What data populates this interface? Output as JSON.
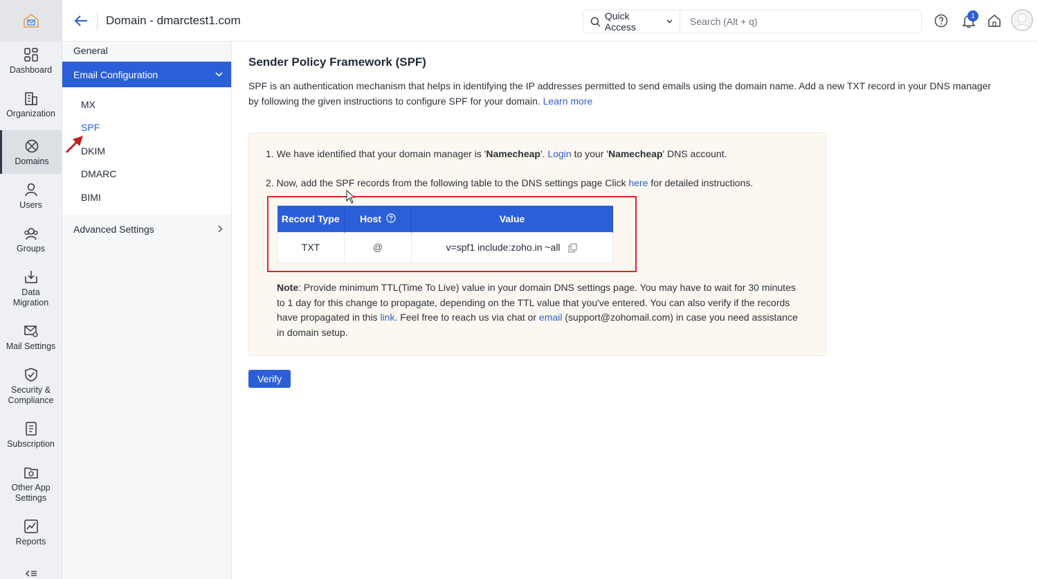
{
  "header": {
    "page_title": "Domain - dmarctest1.com",
    "quick_access_label": "Quick Access",
    "search_placeholder": "Search (Alt + q)",
    "notification_count": "1"
  },
  "rail": {
    "items": [
      {
        "label": "Dashboard",
        "icon": "dashboard-icon"
      },
      {
        "label": "Organization",
        "icon": "organization-icon"
      },
      {
        "label": "Domains",
        "icon": "domains-icon",
        "active": true
      },
      {
        "label": "Users",
        "icon": "user-icon"
      },
      {
        "label": "Groups",
        "icon": "groups-icon"
      },
      {
        "label": "Data Migration",
        "icon": "data-migration-icon"
      },
      {
        "label": "Mail Settings",
        "icon": "mail-settings-icon"
      },
      {
        "label": "Security & Compliance",
        "icon": "shield-check-icon"
      },
      {
        "label": "Subscription",
        "icon": "subscription-icon"
      },
      {
        "label": "Other App Settings",
        "icon": "app-settings-icon"
      },
      {
        "label": "Reports",
        "icon": "reports-icon"
      }
    ]
  },
  "subnav": {
    "general": "General",
    "email_config": "Email Configuration",
    "children": [
      "MX",
      "SPF",
      "DKIM",
      "DMARC",
      "BIMI"
    ],
    "advanced": "Advanced Settings"
  },
  "main": {
    "title": "Sender Policy Framework (SPF)",
    "desc": "SPF is an authentication mechanism that helps in identifying the IP addresses permitted to send emails using the domain name. Add a new TXT record in your DNS manager by following the given instructions to configure SPF for your domain.",
    "learn_more": "Learn more",
    "step1_pre": "1. We have identified that your domain manager is '",
    "step1_manager": "Namecheap",
    "step1_mid": "'. ",
    "step1_login": "Login",
    "step1_mid2": " to your '",
    "step1_manager2": "Namecheap",
    "step1_post": "' DNS account.",
    "step2_pre": "2. Now, add the SPF records from the following table to the DNS settings page Click ",
    "step2_link": "here",
    "step2_post": " for detailed instructions.",
    "table": {
      "headers": [
        "Record Type",
        "Host",
        "Value"
      ],
      "row": [
        "TXT",
        "@",
        "v=spf1 include:zoho.in ~all"
      ]
    },
    "note_label": "Note",
    "note_text1": ": Provide minimum TTL(Time To Live) value in your domain DNS settings page. You may have to wait for 30 minutes to 1 day for this change to propagate, depending on the TTL value that you've entered. You can also verify if the records have propagated in this ",
    "note_link": "link",
    "note_text2": ". Feel free to reach us via chat or ",
    "note_email": "email",
    "note_text3": " (support@zohomail.com) in case you need assistance in domain setup.",
    "verify_label": "Verify"
  },
  "colors": {
    "accent": "#2b5fd9",
    "highlight_box": "#d62828",
    "panel_bg": "#fcf8f1"
  }
}
